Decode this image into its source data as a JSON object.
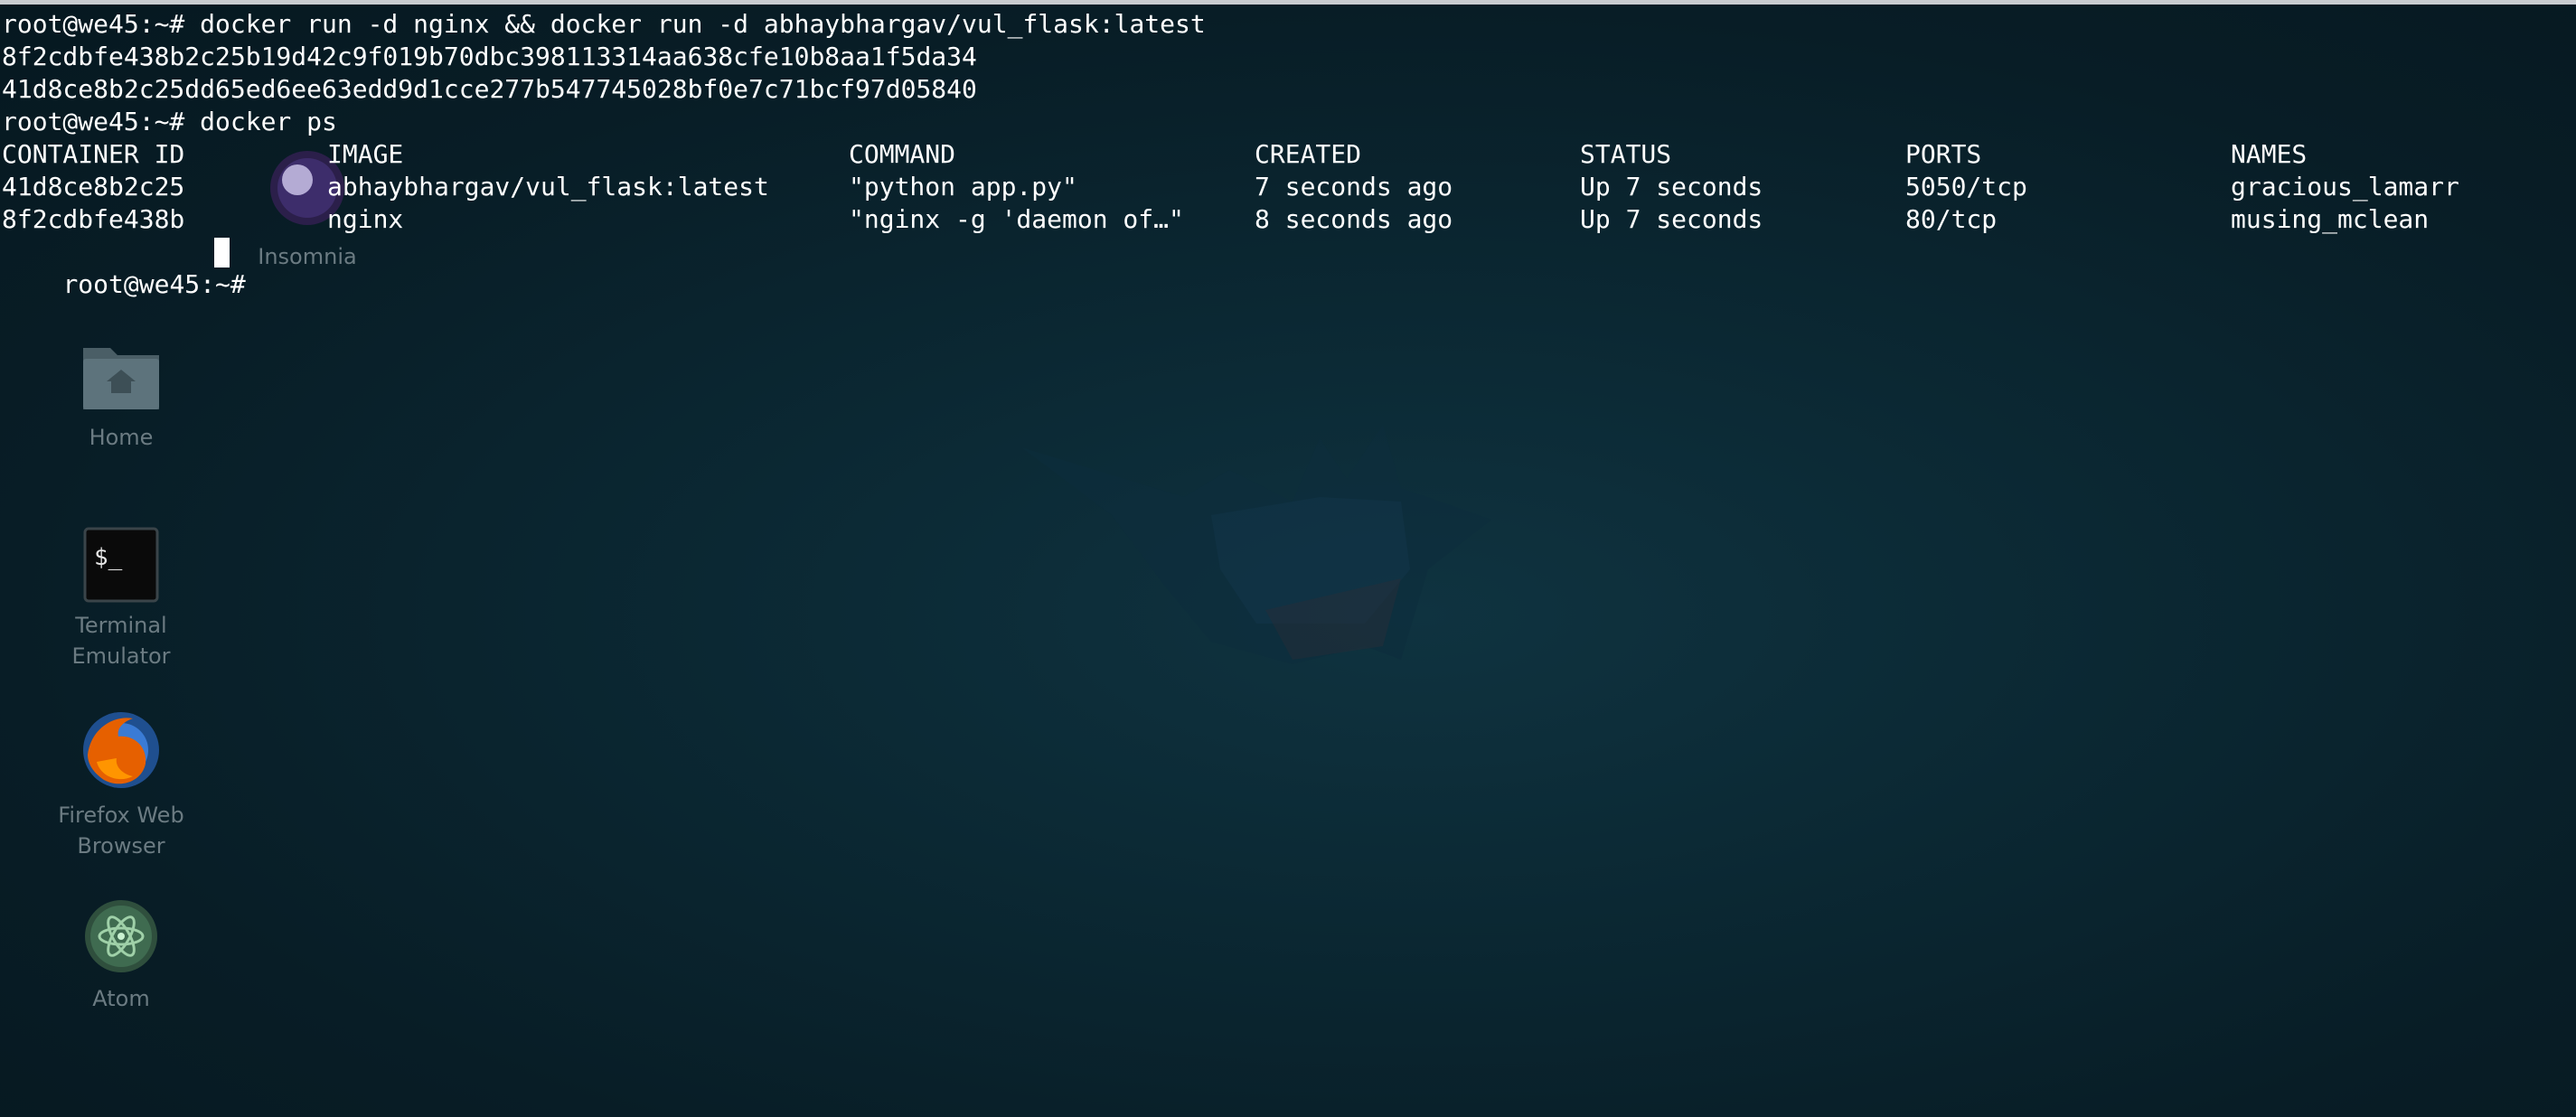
{
  "colors": {
    "background": "#0b2833",
    "terminal_text": "#ffffff",
    "icon_label": "#6b7b82"
  },
  "desktop": {
    "icons": [
      {
        "label": "Insomnia",
        "icon": "insomnia-icon"
      },
      {
        "label": "Home",
        "icon": "home-folder-icon"
      },
      {
        "label": "Terminal Emulator",
        "icon": "terminal-icon"
      },
      {
        "label": "Firefox Web Browser",
        "icon": "firefox-icon"
      },
      {
        "label": "Atom",
        "icon": "atom-icon"
      }
    ]
  },
  "terminal": {
    "lines": [
      "root@we45:~# docker run -d nginx && docker run -d abhaybhargav/vul_flask:latest",
      "8f2cdbfe438b2c25b19d42c9f019b70dbc398113314aa638cfe10b8aa1f5da34",
      "41d8ce8b2c25dd65ed6ee63edd9d1cce277b547745028bf0e7c71bcf97d05840",
      "root@we45:~# docker ps"
    ],
    "table": {
      "headers": [
        "CONTAINER ID",
        "IMAGE",
        "COMMAND",
        "CREATED",
        "STATUS",
        "PORTS",
        "NAMES"
      ],
      "rows": [
        [
          "41d8ce8b2c25",
          "abhaybhargav/vul_flask:latest",
          "\"python app.py\"",
          "7 seconds ago",
          "Up 7 seconds",
          "5050/tcp",
          "gracious_lamarr"
        ],
        [
          "8f2cdbfe438b",
          "nginx",
          "\"nginx -g 'daemon of…\"",
          "8 seconds ago",
          "Up 7 seconds",
          "80/tcp",
          "musing_mclean"
        ]
      ]
    },
    "prompt": "root@we45:~#"
  }
}
